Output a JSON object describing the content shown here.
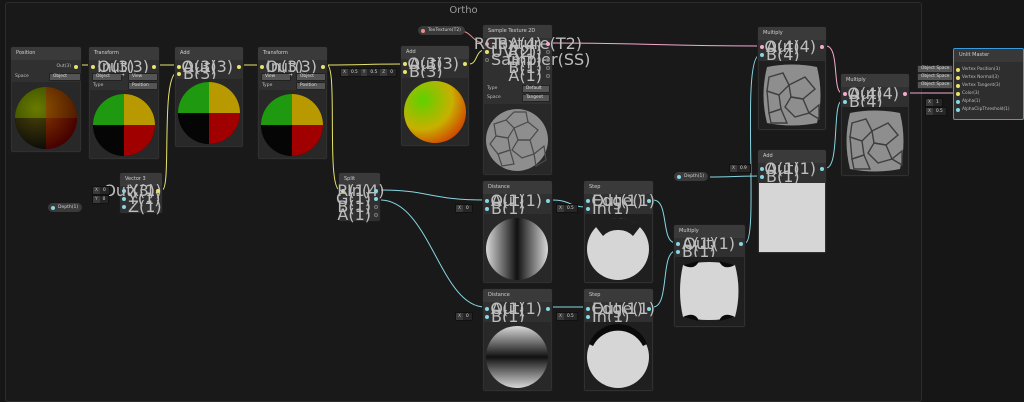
{
  "group": {
    "title": "Ortho"
  },
  "colors": {
    "vec3": "#e8e36a",
    "vec4": "#f4a9cf",
    "vec1": "#86d6e3",
    "tex": "#f08a8a",
    "accent": "#3a9be0"
  },
  "nodes": {
    "position": {
      "title": "Position",
      "out": "Out(3)",
      "space_label": "Space",
      "space_value": "Object"
    },
    "transform1": {
      "title": "Transform",
      "in": "In(3)",
      "out": "Out(3)",
      "from": "Object",
      "to": "View",
      "type_label": "Type",
      "type_value": "Position"
    },
    "add1": {
      "title": "Add",
      "a": "A(3)",
      "b": "B(3)",
      "out": "Out(3)"
    },
    "transform2": {
      "title": "Transform",
      "in": "In(3)",
      "out": "Out(3)",
      "from": "View",
      "to": "Object",
      "type_label": "Type",
      "type_value": "Position"
    },
    "add2": {
      "title": "Add",
      "a": "A(3)",
      "b": "B(3)",
      "out": "Out(3)"
    },
    "vector3": {
      "title": "Vector 3",
      "x": "X(1)",
      "y": "Y(1)",
      "z": "Z(1)",
      "out": "Out(3)"
    },
    "sample_tex": {
      "title": "Sample Texture 2D",
      "texture": "Texture(T2)",
      "uv": "UV(2)",
      "sampler": "Sampler(SS)",
      "rgba": "RGBA(4)",
      "r": "R(1)",
      "g": "G(1)",
      "b": "B(1)",
      "a": "A(1)",
      "type_label": "Type",
      "type_value": "Default",
      "space_label": "Space",
      "space_value": "Tangent"
    },
    "split": {
      "title": "Split",
      "in": "In(4)",
      "r": "R(1)",
      "g": "G(1)",
      "b": "B(1)",
      "a": "A(1)"
    },
    "distance1": {
      "title": "Distance",
      "a": "A(1)",
      "b": "B(1)",
      "out": "Out(1)"
    },
    "distance2": {
      "title": "Distance",
      "a": "A(1)",
      "b": "B(1)",
      "out": "Out(1)"
    },
    "step1": {
      "title": "Step",
      "edge": "Edge(1)",
      "in": "In(1)",
      "out": "Out(1)"
    },
    "step2": {
      "title": "Step",
      "edge": "Edge(1)",
      "in": "In(1)",
      "out": "Out(1)"
    },
    "multiply_mid": {
      "title": "Multiply",
      "a": "A(1)",
      "b": "B(1)",
      "out": "Out(1)"
    },
    "multiply_top": {
      "title": "Multiply",
      "a": "A(4)",
      "b": "B(4)",
      "out": "Out(4)"
    },
    "add3": {
      "title": "Add",
      "a": "A(1)",
      "b": "B(1)",
      "out": "Out(1)"
    },
    "multiply_right": {
      "title": "Multiply",
      "a": "A(4)",
      "b": "B(4)",
      "out": "Out(4)"
    }
  },
  "properties": {
    "tex_texture": "TexTexture(T2)",
    "depth1": "Depth(1)",
    "depth2": "Depth(1)"
  },
  "fields": {
    "add2_b": {
      "x": "0.5",
      "y": "0.5",
      "z": "0"
    },
    "vec_x": "0",
    "vec_y": "0",
    "dist1_b": "0",
    "dist2_b": "0",
    "step1_edge": "0.5",
    "step2_edge": "0.5",
    "add3_a": "0.9",
    "master_alpha": "1",
    "master_clip": "0.5"
  },
  "master": {
    "title": "Unlit Master",
    "ports": [
      "Vertex Position(3)",
      "Vertex Normal(3)",
      "Vertex Tangent(3)",
      "Color(3)",
      "Alpha(1)",
      "AlphaClipThreshold(1)"
    ],
    "space_options": [
      "Object Space",
      "Object Space",
      "Object Space"
    ]
  }
}
